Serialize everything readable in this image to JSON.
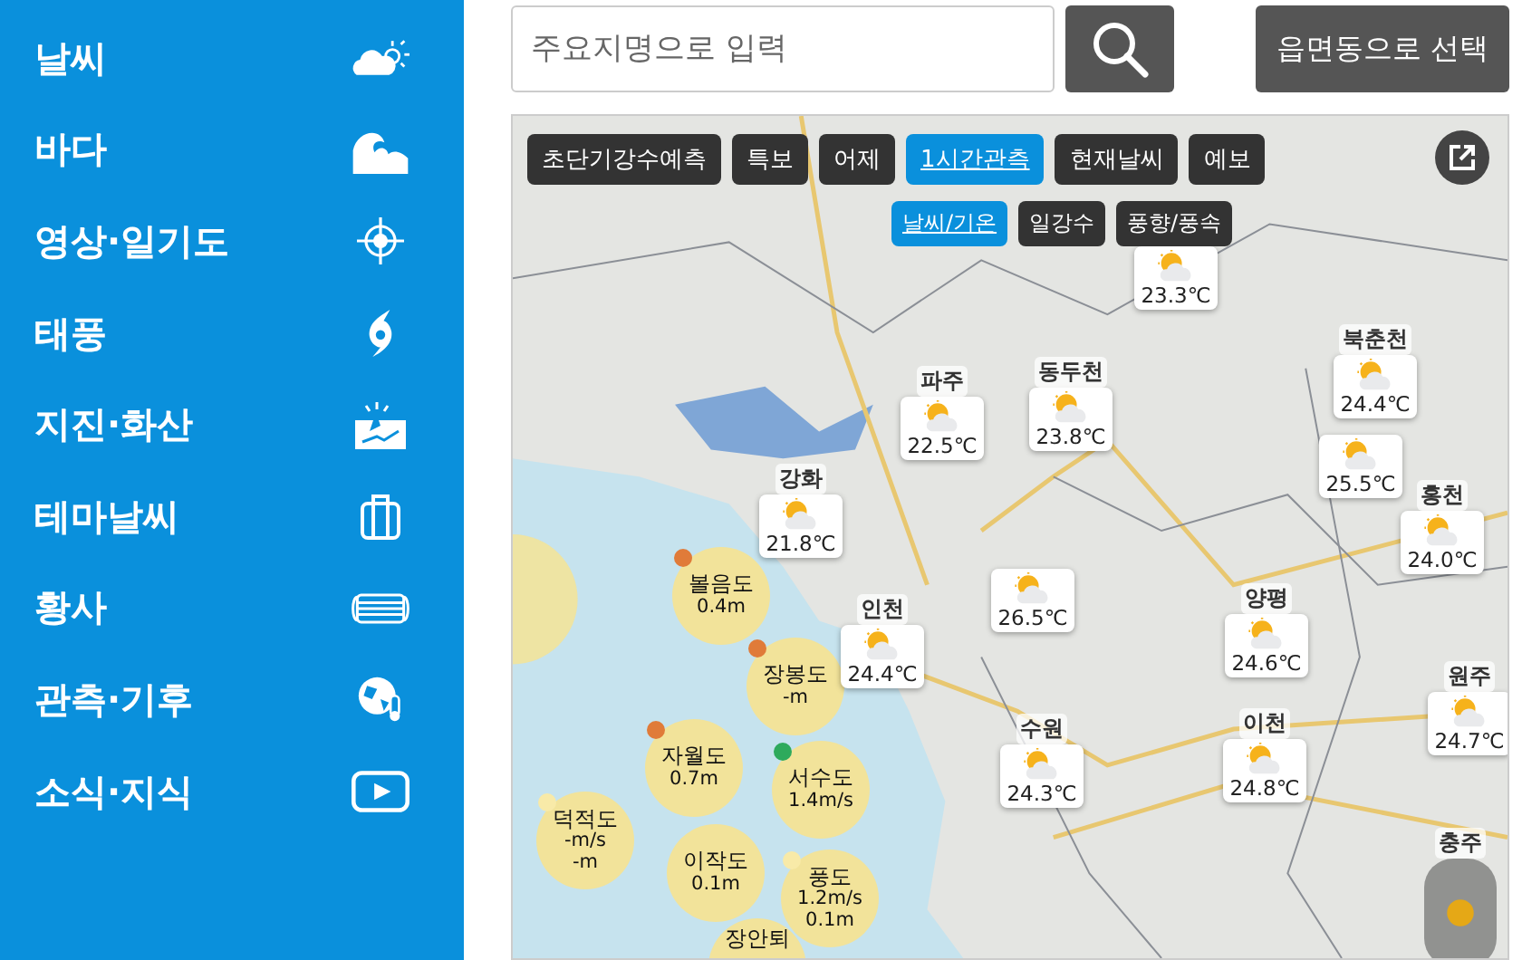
{
  "sidebar": {
    "items": [
      {
        "label": "날씨"
      },
      {
        "label": "바다"
      },
      {
        "label": "영상·일기도"
      },
      {
        "label": "태풍"
      },
      {
        "label": "지진·화산"
      },
      {
        "label": "테마날씨"
      },
      {
        "label": "황사"
      },
      {
        "label": "관측·기후"
      },
      {
        "label": "소식·지식"
      }
    ]
  },
  "search": {
    "placeholder": "주요지명으로 입력"
  },
  "region_button": "읍면동으로 선택",
  "map": {
    "tabs": [
      {
        "label": "초단기강수예측",
        "selected": false
      },
      {
        "label": "특보",
        "selected": false
      },
      {
        "label": "어제",
        "selected": false
      },
      {
        "label": "1시간관측",
        "selected": true
      },
      {
        "label": "현재날씨",
        "selected": false
      },
      {
        "label": "예보",
        "selected": false
      }
    ],
    "subtabs": [
      {
        "label": "날씨/기온",
        "selected": true
      },
      {
        "label": "일강수",
        "selected": false
      },
      {
        "label": "풍향/풍속",
        "selected": false
      }
    ],
    "weather_markers": [
      {
        "kind": "card",
        "temp": "23.3℃"
      },
      {
        "kind": "card",
        "name": "파주",
        "temp": "22.5℃"
      },
      {
        "kind": "card",
        "name": "동두천",
        "temp": "23.8℃"
      },
      {
        "kind": "card",
        "name": "북춘천",
        "temp": "24.4℃"
      },
      {
        "kind": "card",
        "name": "강화",
        "temp": "21.8℃"
      },
      {
        "kind": "card",
        "temp": "25.5℃"
      },
      {
        "kind": "card",
        "name": "홍천",
        "temp": "24.0℃"
      },
      {
        "kind": "card",
        "name": "인천",
        "temp": "24.4℃"
      },
      {
        "kind": "card",
        "temp": "26.5℃"
      },
      {
        "kind": "card",
        "name": "양평",
        "temp": "24.6℃"
      },
      {
        "kind": "card",
        "name": "원주",
        "temp": "24.7℃"
      },
      {
        "kind": "card",
        "name": "수원",
        "temp": "24.3℃"
      },
      {
        "kind": "card",
        "name": "이천",
        "temp": "24.8℃"
      },
      {
        "kind": "dark",
        "name": "충주"
      }
    ],
    "sea_markers": [
      {
        "name": "볼음도",
        "values": [
          "0.4m"
        ],
        "color": "#e07b39"
      },
      {
        "name": "장봉도",
        "values": [
          "-m"
        ],
        "color": "#e07b39"
      },
      {
        "name": "자월도",
        "values": [
          "0.7m"
        ],
        "color": "#e07b39"
      },
      {
        "name": "서수도",
        "values": [
          "1.4m/s"
        ],
        "color": "#2eaa5c"
      },
      {
        "name": "덕적도",
        "values": [
          "-m/s",
          "-m"
        ],
        "color": "#f8eaa8"
      },
      {
        "name": "이작도",
        "values": [
          "0.1m"
        ]
      },
      {
        "name": "풍도",
        "values": [
          "1.2m/s",
          "0.1m"
        ],
        "color": "#f8eaa8"
      },
      {
        "name": "장안퇴"
      }
    ]
  }
}
